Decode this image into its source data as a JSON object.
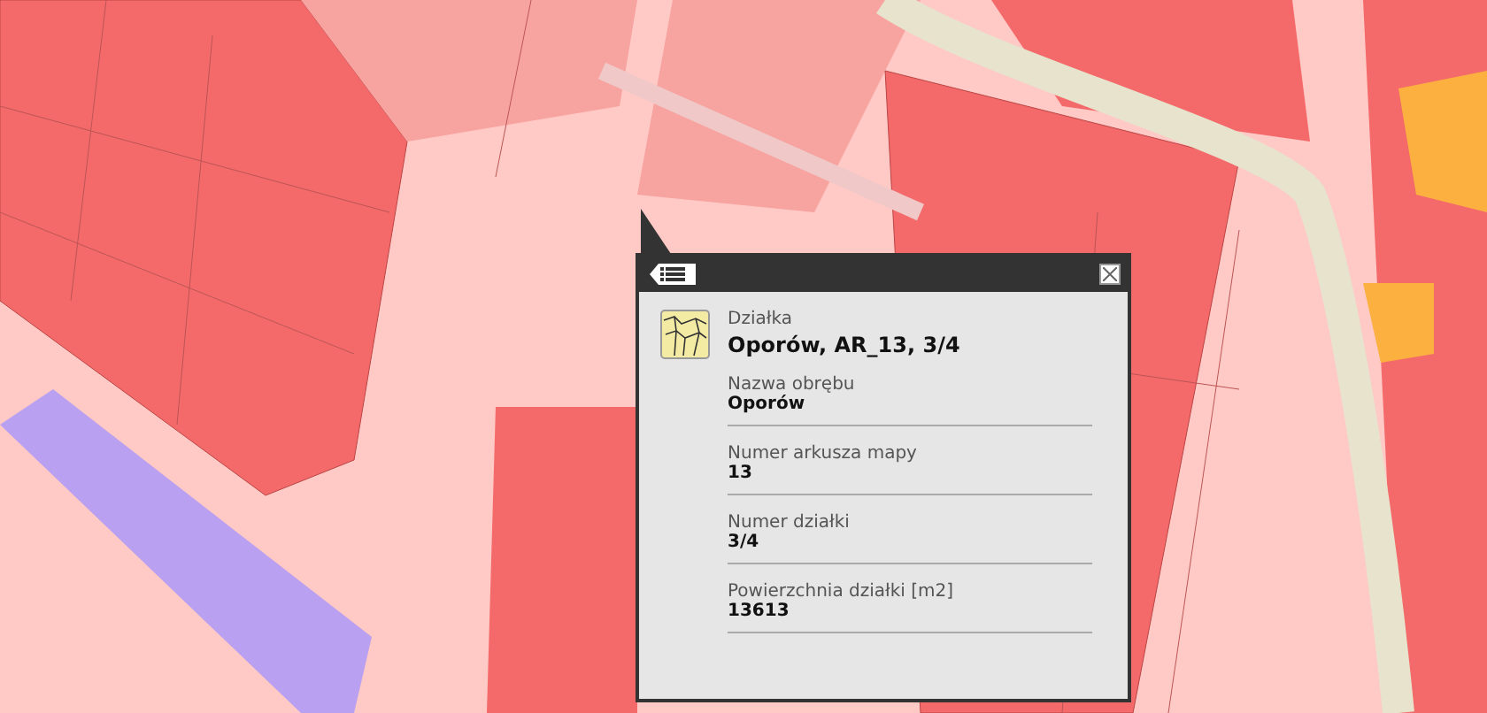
{
  "popup": {
    "layer": "Działka",
    "title": "Oporów, AR_13, 3/4",
    "fields": [
      {
        "label": "Nazwa obrębu",
        "value": "Oporów"
      },
      {
        "label": "Numer arkusza mapy",
        "value": "13"
      },
      {
        "label": "Numer działki",
        "value": "3/4"
      },
      {
        "label": "Powierzchnia działki [m2]",
        "value": "13613"
      }
    ]
  }
}
